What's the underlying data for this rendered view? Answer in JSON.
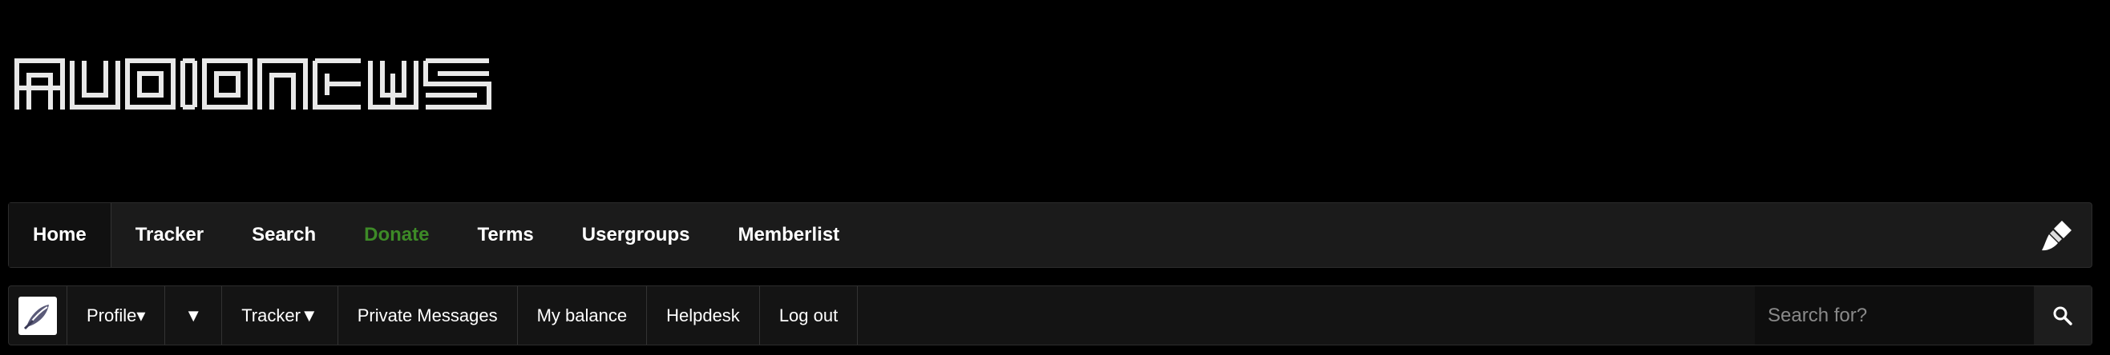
{
  "logo": {
    "alt": "AUDIONEWS"
  },
  "nav": {
    "items": [
      {
        "label": "Home"
      },
      {
        "label": "Tracker"
      },
      {
        "label": "Search"
      },
      {
        "label": "Donate"
      },
      {
        "label": "Terms"
      },
      {
        "label": "Usergroups"
      },
      {
        "label": "Memberlist"
      }
    ],
    "theme_icon": "paintbrush-icon",
    "donate_color": "#3d8a27"
  },
  "userbar": {
    "profile": "Profile▾",
    "dropdown": "▼",
    "tracker": "Tracker▼",
    "private_messages": "Private Messages",
    "balance": "My balance",
    "helpdesk": "Helpdesk",
    "logout": "Log out"
  },
  "search": {
    "placeholder": "Search for?",
    "icon": "search-icon"
  }
}
